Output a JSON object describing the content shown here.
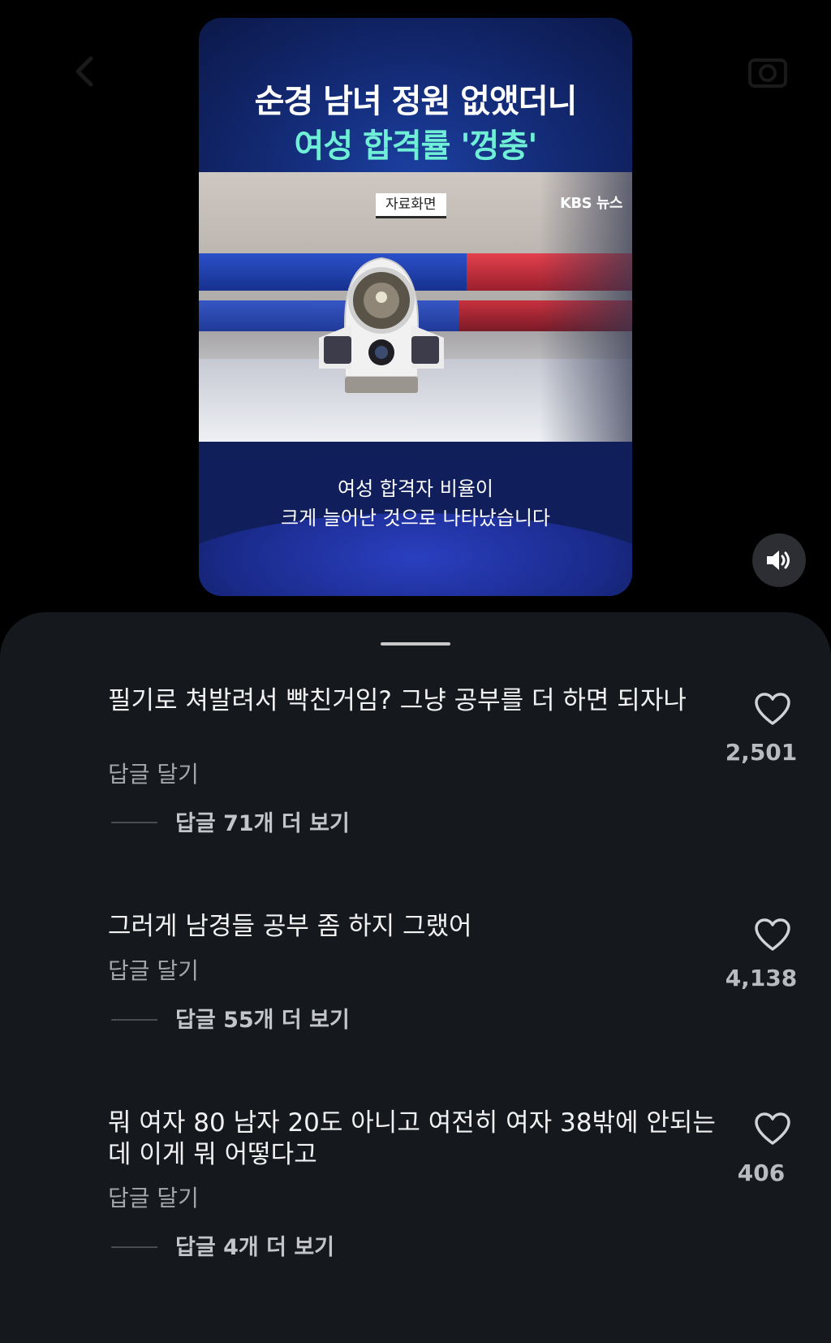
{
  "video": {
    "headline_line1": "순경 남녀 정원 없앴더니",
    "headline_line2": "여성 합격률 '껑충'",
    "caption_tag": "자료화면",
    "broadcaster_logo": "KBS 뉴스",
    "subtitle_line1": "여성 합격자 비율이",
    "subtitle_line2": "크게 늘어난 것으로 나타났습니다",
    "accent_color": "#6ff0d6"
  },
  "controls": {
    "back_icon": "chevron-left-icon",
    "camera_icon": "camera-icon",
    "volume_icon": "speaker-on-icon"
  },
  "comments": [
    {
      "text": "필기로 쳐발려서 빡친거임? 그냥 공부를 더 하면 되자나",
      "reply_label": "답글 달기",
      "more_replies": "답글 71개 더 보기",
      "likes": "2,501"
    },
    {
      "text": "그러게 남경들 공부 좀 하지 그랬어",
      "reply_label": "답글 달기",
      "more_replies": "답글 55개 더 보기",
      "likes": "4,138"
    },
    {
      "text": "뭐 여자 80 남자 20도 아니고 여전히 여자 38밖에 안되는데 이게 뭐 어떻다고",
      "reply_label": "답글 달기",
      "more_replies": "답글 4개 더 보기",
      "likes": "406"
    }
  ]
}
